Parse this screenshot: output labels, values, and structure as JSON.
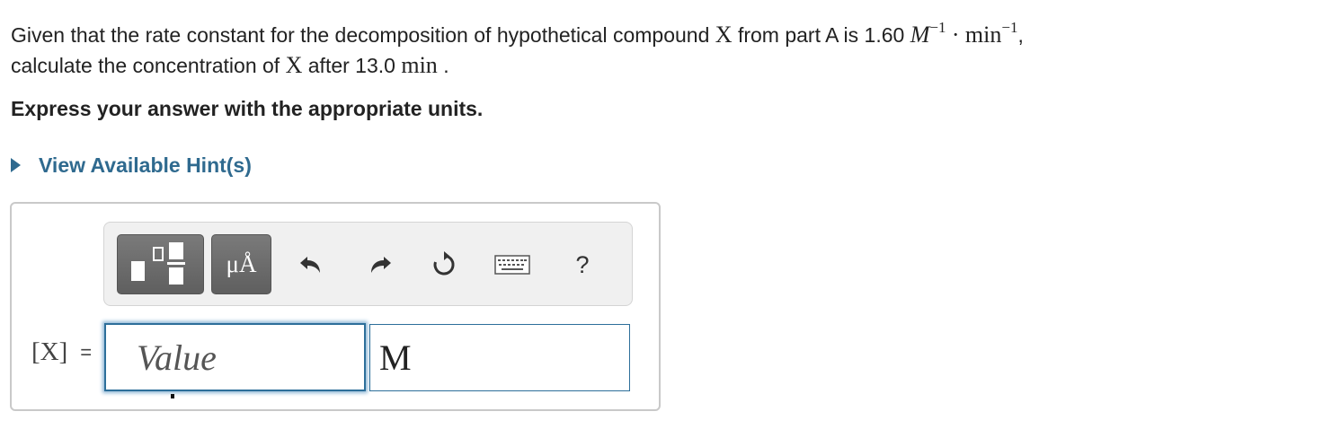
{
  "question": {
    "line1_pre": "Given that the rate constant for the decomposition of hypothetical compound",
    "compound": "X",
    "line1_mid": "from part A is 1.60",
    "unit_M": "M",
    "exp1": "−1",
    "dot": "·",
    "unit_min": "min",
    "exp2": "−1",
    "line1_end": ",",
    "line2_pre": "calculate the concentration of",
    "compound2": "X",
    "line2_mid": "after 13.0",
    "time_unit": "min",
    "line2_end": "."
  },
  "instruction": "Express your answer with the appropriate units.",
  "hint": {
    "label": "View Available Hint(s)"
  },
  "toolbar": {
    "units_label": "μÅ",
    "help_label": "?",
    "icons": [
      "templates-icon",
      "units-icon",
      "undo-icon",
      "redo-icon",
      "reset-icon",
      "keyboard-icon",
      "help-icon"
    ]
  },
  "answer": {
    "variable_label": "[X]",
    "equals": "=",
    "value_placeholder": "Value",
    "value": "",
    "unit_value": "M"
  },
  "colors": {
    "link": "#2f6a8f",
    "input_border": "#2d6f9a",
    "toolbar_button": "#6b6b6b"
  }
}
